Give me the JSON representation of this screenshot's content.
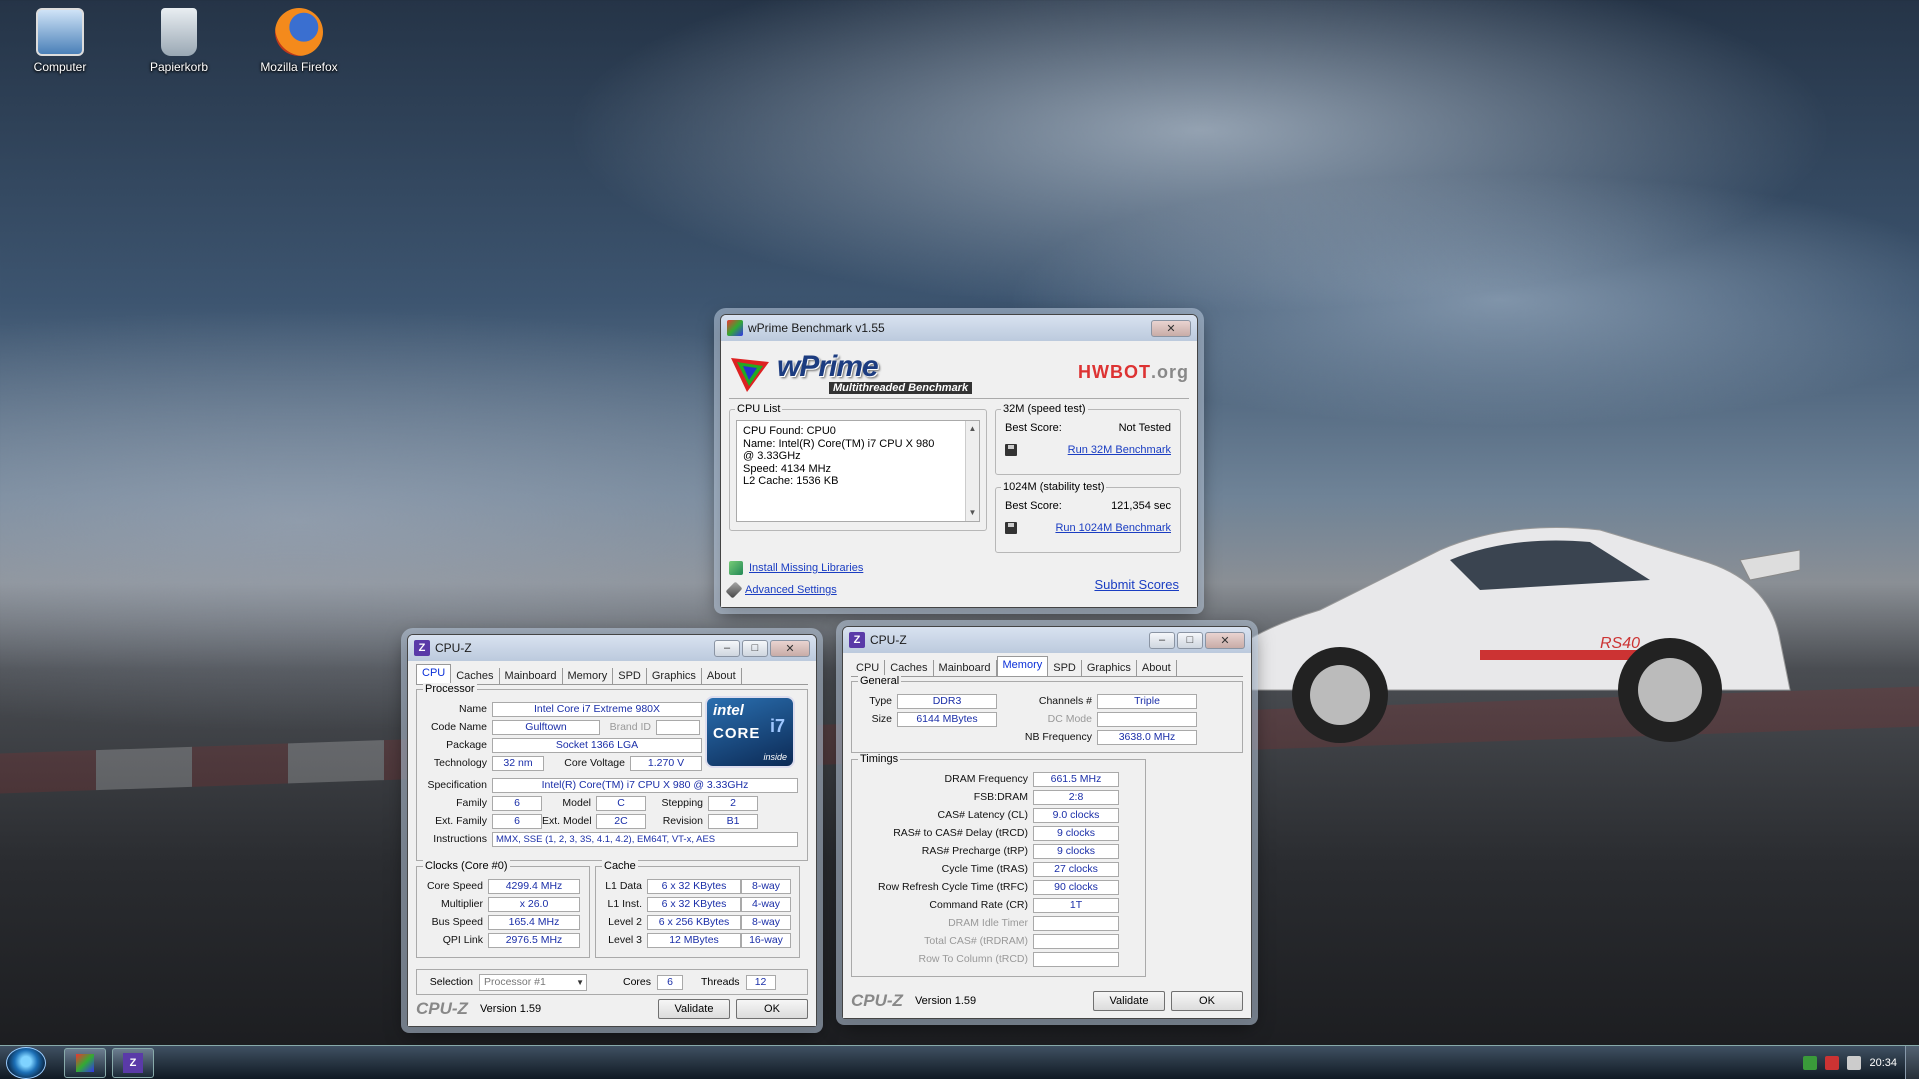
{
  "desktop": {
    "icons": [
      {
        "label": "Computer",
        "icon": "computer-icon"
      },
      {
        "label": "Papierkorb",
        "icon": "recycle-bin-icon"
      },
      {
        "label": "Mozilla Firefox",
        "icon": "firefox-icon"
      }
    ],
    "car_plate": "RS40"
  },
  "wprime": {
    "title": "wPrime Benchmark v1.55",
    "logo_name": "wPrime",
    "logo_sub": "Multithreaded Benchmark",
    "hwbot_prefix": "HWBOT",
    "hwbot_suffix": ".org",
    "cpu_list": {
      "legend": "CPU List",
      "lines": [
        "CPU Found: CPU0",
        "Name:    Intel(R) Core(TM) i7 CPU        X 980",
        "@ 3.33GHz",
        "Speed:   4134 MHz",
        "L2 Cache: 1536 KB"
      ]
    },
    "test_32m": {
      "legend": "32M (speed test)",
      "best_label": "Best Score:",
      "best_value": "Not Tested",
      "run_label": "Run 32M Benchmark"
    },
    "test_1024m": {
      "legend": "1024M (stability test)",
      "best_label": "Best Score:",
      "best_value": "121,354 sec",
      "run_label": "Run 1024M Benchmark"
    },
    "install_label": "Install Missing Libraries",
    "advanced_label": "Advanced Settings",
    "submit_label": "Submit Scores"
  },
  "cpuz_cpu": {
    "title": "CPU-Z",
    "tabs": [
      "CPU",
      "Caches",
      "Mainboard",
      "Memory",
      "SPD",
      "Graphics",
      "About"
    ],
    "active_tab": "CPU",
    "processor": {
      "legend": "Processor",
      "name_label": "Name",
      "name": "Intel Core i7 Extreme 980X",
      "codename_label": "Code Name",
      "codename": "Gulftown",
      "brandid_label": "Brand ID",
      "package_label": "Package",
      "package": "Socket 1366 LGA",
      "tech_label": "Technology",
      "tech": "32 nm",
      "voltage_label": "Core Voltage",
      "voltage": "1.270 V",
      "spec_label": "Specification",
      "spec": "Intel(R) Core(TM) i7 CPU        X 980  @ 3.33GHz",
      "family_label": "Family",
      "family": "6",
      "model_label": "Model",
      "model": "C",
      "stepping_label": "Stepping",
      "stepping": "2",
      "extfamily_label": "Ext. Family",
      "extfamily": "6",
      "extmodel_label": "Ext. Model",
      "extmodel": "2C",
      "revision_label": "Revision",
      "revision": "B1",
      "instr_label": "Instructions",
      "instr": "MMX, SSE (1, 2, 3, 3S, 4.1, 4.2), EM64T, VT-x, AES"
    },
    "logo": {
      "brand": "intel",
      "line": "CORE",
      "model": "i7",
      "tag": "inside"
    },
    "clocks": {
      "legend": "Clocks (Core #0)",
      "core_speed_label": "Core Speed",
      "core_speed": "4299.4 MHz",
      "multiplier_label": "Multiplier",
      "multiplier": "x 26.0",
      "bus_speed_label": "Bus Speed",
      "bus_speed": "165.4 MHz",
      "qpi_label": "QPI Link",
      "qpi": "2976.5 MHz"
    },
    "cache": {
      "legend": "Cache",
      "rows": [
        {
          "label": "L1 Data",
          "size": "6 x 32 KBytes",
          "way": "8-way"
        },
        {
          "label": "L1 Inst.",
          "size": "6 x 32 KBytes",
          "way": "4-way"
        },
        {
          "label": "Level 2",
          "size": "6 x 256 KBytes",
          "way": "8-way"
        },
        {
          "label": "Level 3",
          "size": "12 MBytes",
          "way": "16-way"
        }
      ]
    },
    "selection_label": "Selection",
    "selection": "Processor #1",
    "cores_label": "Cores",
    "cores": "6",
    "threads_label": "Threads",
    "threads": "12",
    "brand": "CPU-Z",
    "version": "Version 1.59",
    "validate": "Validate",
    "ok": "OK"
  },
  "cpuz_mem": {
    "title": "CPU-Z",
    "tabs": [
      "CPU",
      "Caches",
      "Mainboard",
      "Memory",
      "SPD",
      "Graphics",
      "About"
    ],
    "active_tab": "Memory",
    "general": {
      "legend": "General",
      "type_label": "Type",
      "type": "DDR3",
      "size_label": "Size",
      "size": "6144 MBytes",
      "channels_label": "Channels #",
      "channels": "Triple",
      "dcmode_label": "DC Mode",
      "dcmode": "",
      "nbfreq_label": "NB Frequency",
      "nbfreq": "3638.0 MHz"
    },
    "timings": {
      "legend": "Timings",
      "rows": [
        {
          "label": "DRAM Frequency",
          "value": "661.5 MHz",
          "dim": false
        },
        {
          "label": "FSB:DRAM",
          "value": "2:8",
          "dim": false
        },
        {
          "label": "CAS# Latency (CL)",
          "value": "9.0 clocks",
          "dim": false
        },
        {
          "label": "RAS# to CAS# Delay (tRCD)",
          "value": "9 clocks",
          "dim": false
        },
        {
          "label": "RAS# Precharge (tRP)",
          "value": "9 clocks",
          "dim": false
        },
        {
          "label": "Cycle Time (tRAS)",
          "value": "27 clocks",
          "dim": false
        },
        {
          "label": "Row Refresh Cycle Time (tRFC)",
          "value": "90 clocks",
          "dim": false
        },
        {
          "label": "Command Rate (CR)",
          "value": "1T",
          "dim": false
        },
        {
          "label": "DRAM Idle Timer",
          "value": "",
          "dim": true
        },
        {
          "label": "Total CAS# (tRDRAM)",
          "value": "",
          "dim": true
        },
        {
          "label": "Row To Column (tRCD)",
          "value": "",
          "dim": true
        }
      ]
    },
    "brand": "CPU-Z",
    "version": "Version 1.59",
    "validate": "Validate",
    "ok": "OK"
  },
  "taskbar": {
    "items": [
      {
        "icon": "wprime-icon",
        "label": ""
      },
      {
        "icon": "cpuz-icon",
        "label": "Z"
      }
    ],
    "clock": "20:34"
  },
  "colors": {
    "link": "#1a3dc2",
    "value_text": "#1a2ea8",
    "active_tab": "#0a2fd8"
  }
}
